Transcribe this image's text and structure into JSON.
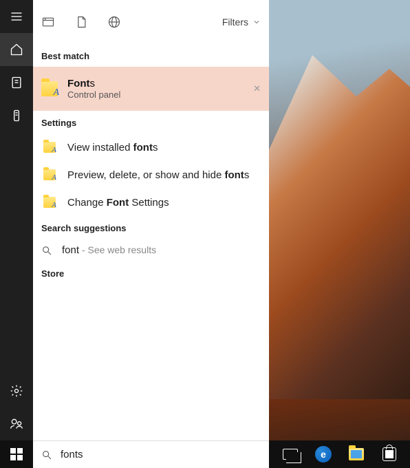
{
  "rail": {
    "menu": "menu",
    "home": "home",
    "clipboard": "clipboard",
    "device": "device",
    "settings": "settings",
    "people": "people"
  },
  "header": {
    "filters_label": "Filters"
  },
  "sections": {
    "best_match": "Best match",
    "settings": "Settings",
    "search_suggestions": "Search suggestions",
    "store": "Store"
  },
  "best_match": {
    "title_prefix": "Font",
    "title_suffix": "s",
    "subtitle": "Control panel"
  },
  "settings_results": [
    {
      "prefix": "View installed ",
      "bold": "font",
      "suffix": "s"
    },
    {
      "prefix": "Preview, delete, or show and hide ",
      "bold": "font",
      "suffix": "s"
    },
    {
      "prefix": "Change ",
      "bold": "Font",
      "suffix": " Settings"
    }
  ],
  "search_suggestion": {
    "term": "font",
    "separator": " - ",
    "hint": "See web results"
  },
  "search": {
    "value": "fonts",
    "placeholder": ""
  },
  "taskbar": {
    "start": "start",
    "taskview": "task-view",
    "edge": "microsoft-edge",
    "explorer": "file-explorer",
    "store": "microsoft-store"
  }
}
